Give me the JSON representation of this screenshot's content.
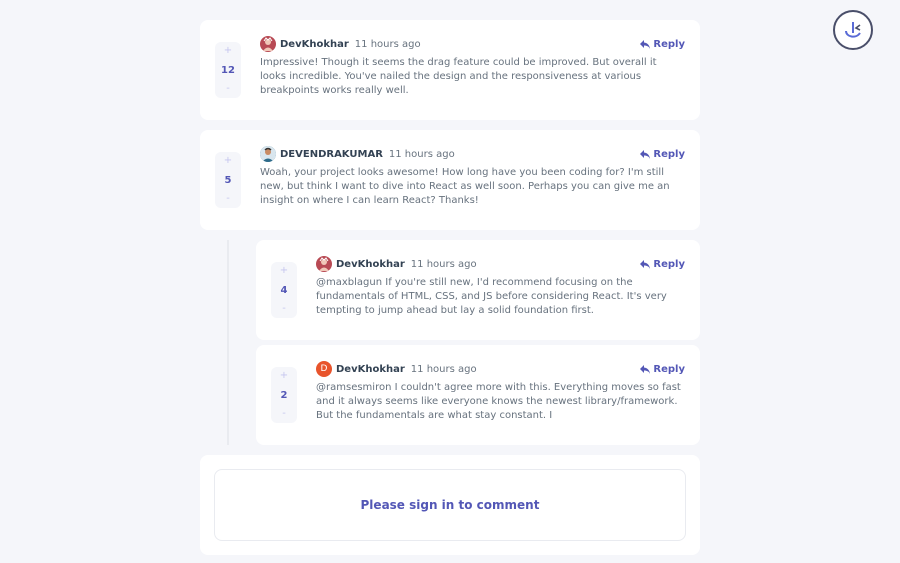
{
  "comments": [
    {
      "username": "DevKhokhar",
      "time": "11 hours ago",
      "score": "12",
      "reply_label": "Reply",
      "text": "Impressive! Though it seems the drag feature could be improved. But overall it looks incredible. You've nailed the design and the responsiveness at various breakpoints works really well.",
      "avatar": "avatar-image"
    },
    {
      "username": "DEVENDRAKUMAR",
      "time": "11 hours ago",
      "score": "5",
      "reply_label": "Reply",
      "text": "Woah, your project looks awesome! How long have you been coding for? I'm still new, but think I want to dive into React as well soon. Perhaps you can give me an insight on where I can learn React? Thanks!",
      "avatar": "avatar-image"
    }
  ],
  "replies": [
    {
      "username": "DevKhokhar",
      "time": "11 hours ago",
      "score": "4",
      "reply_label": "Reply",
      "text": "@maxblagun If you're still new, I'd recommend focusing on the fundamentals of HTML, CSS, and JS before considering React. It's very tempting to jump ahead but lay a solid foundation first.",
      "avatar": "avatar-image"
    },
    {
      "username": "DevKhokhar",
      "time": "11 hours ago",
      "score": "2",
      "reply_label": "Reply",
      "text": "@ramsesmiron I couldn't agree more with this. Everything moves so fast and it always seems like everyone knows the newest library/framework. But the fundamentals are what stay constant. I",
      "avatar_letter": "D"
    }
  ],
  "vote": {
    "plus": "+",
    "minus": "-"
  },
  "signin": {
    "text": "Please sign in to comment"
  },
  "colors": {
    "accent": "#5357b6",
    "background": "#f5f6fa",
    "username": "#334253",
    "body_text": "#67727e"
  },
  "icons": {
    "reply": "reply-arrow-icon",
    "logo": "app-logo-icon"
  }
}
